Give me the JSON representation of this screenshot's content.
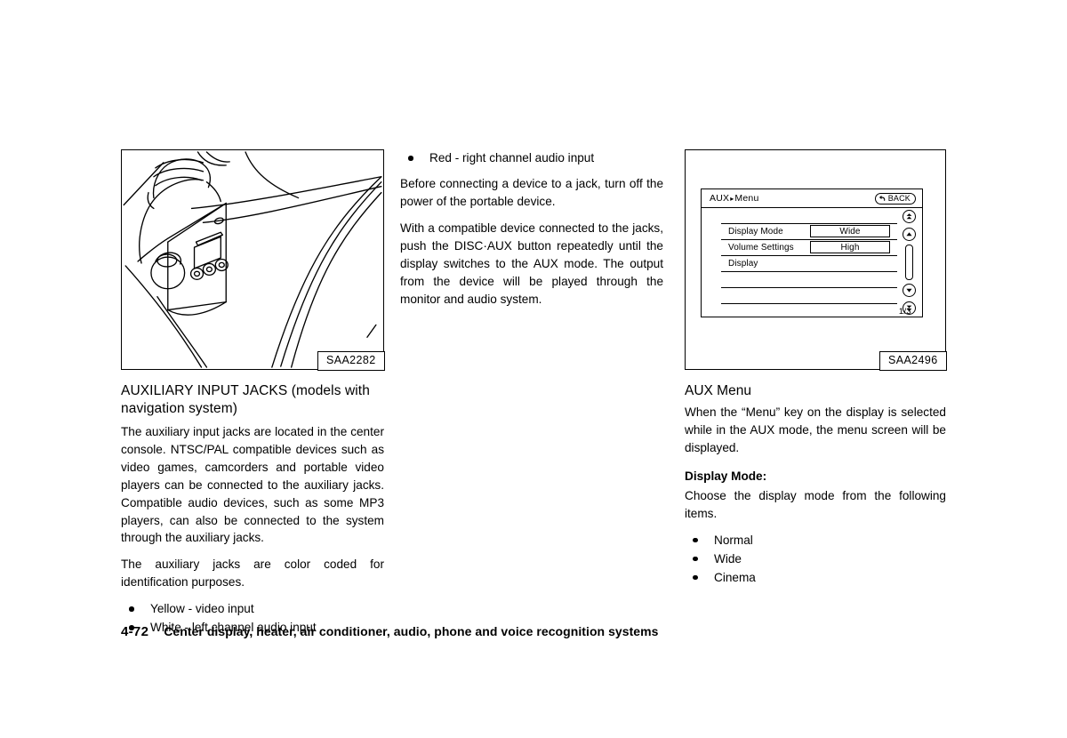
{
  "page": {
    "number": "4-72",
    "footer_text": "Center display, heater, air conditioner, audio, phone and voice recognition systems"
  },
  "left_column": {
    "figure": {
      "caption": "SAA2282",
      "alt": "Line drawing of center console showing auxiliary input jacks"
    },
    "heading": "AUXILIARY INPUT JACKS (models with navigation system)",
    "paragraphs": [
      "The auxiliary input jacks are located in the center console. NTSC/PAL compatible devices such as video games, camcorders and portable video players can be connected to the auxiliary jacks. Compatible audio devices, such as some MP3 players, can also be connected to the system through the auxiliary jacks.",
      "The auxiliary jacks are color coded for identification purposes."
    ],
    "bullets": [
      "Yellow - video input",
      "White - left channel audio input"
    ]
  },
  "middle_column": {
    "bullets": [
      "Red - right channel audio input"
    ],
    "paragraphs": [
      "Before connecting a device to a jack, turn off the power of the portable device.",
      "With a compatible device connected to the jacks, push the DISC·AUX button repeatedly until the display switches to the AUX mode. The output from the device will be played through the monitor and audio system."
    ]
  },
  "right_column": {
    "figure": {
      "caption": "SAA2496",
      "monitor": {
        "title_prefix": "AUX",
        "title_separator": "▸",
        "title_current": "Menu",
        "back_label": "BACK",
        "menu_items": [
          {
            "label": "Display Mode",
            "value": "Wide"
          },
          {
            "label": "Volume Settings",
            "value": "High"
          },
          {
            "label": "Display",
            "value": ""
          },
          {
            "label": "",
            "value": ""
          },
          {
            "label": "",
            "value": ""
          }
        ],
        "page_indicator": "1/3"
      }
    },
    "heading": "AUX Menu",
    "paragraphs": [
      "When the “Menu” key on the display is selected while in the AUX mode, the menu screen will be displayed."
    ],
    "subheading": "Display Mode:",
    "subparagraph": "Choose the display mode from the following items.",
    "bullets": [
      "Normal",
      "Wide",
      "Cinema"
    ]
  }
}
